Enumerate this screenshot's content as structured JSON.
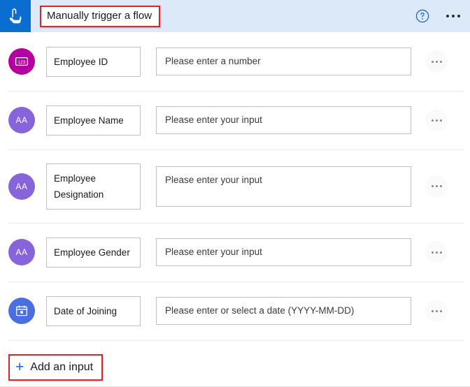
{
  "header": {
    "trigger_icon": "tap-hand-icon",
    "title": "Manually trigger a flow",
    "help_icon": "help-circle-icon",
    "more_icon": "ellipsis-menu-icon",
    "tile_color": "#0a6ed1",
    "background_color": "#dce9f8",
    "highlight_color": "#d8262b"
  },
  "rows": [
    {
      "icon": "number-123-icon",
      "icon_color": "#b4009e",
      "name": "Employee ID",
      "placeholder": "Please enter a number",
      "more_icon": "row-ellipsis-icon"
    },
    {
      "icon": "text-aa-icon",
      "icon_color": "#8764da",
      "name": "Employee Name",
      "placeholder": "Please enter your input",
      "more_icon": "row-ellipsis-icon"
    },
    {
      "icon": "text-aa-icon",
      "icon_color": "#8764da",
      "name": "Employee Designation",
      "placeholder": "Please enter your input",
      "more_icon": "row-ellipsis-icon"
    },
    {
      "icon": "text-aa-icon",
      "icon_color": "#8764da",
      "name": "Employee Gender",
      "placeholder": "Please enter your input",
      "more_icon": "row-ellipsis-icon"
    },
    {
      "icon": "calendar-date-icon",
      "icon_color": "#4a6fe0",
      "name": "Date of Joining",
      "placeholder": "Please enter or select a date (YYYY-MM-DD)",
      "more_icon": "row-ellipsis-icon"
    }
  ],
  "footer": {
    "plus_glyph": "+",
    "add_input_label": "Add an input",
    "accent_color": "#0a6ed1",
    "highlight_color": "#d8262b"
  }
}
